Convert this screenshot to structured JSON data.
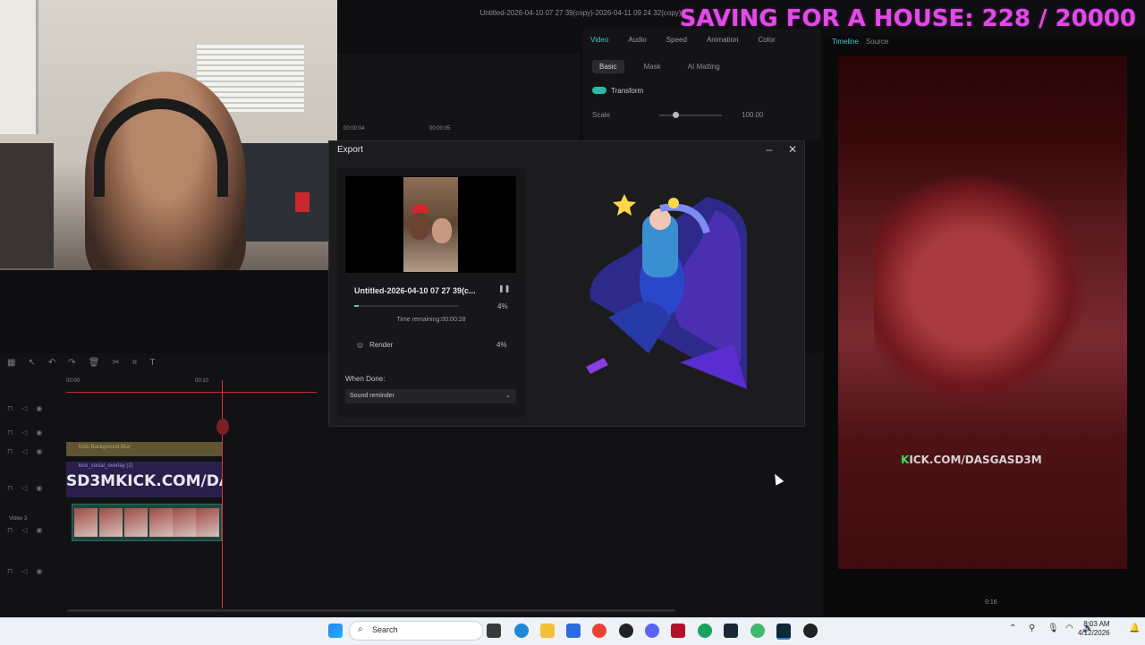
{
  "window": {
    "title": "Untitled-2026-04-10 07 27 39(copy)-2026-04-11 09 24 32(copy)"
  },
  "overlay": {
    "goal_text": "SAVING FOR A HOUSE: 228 / 20000"
  },
  "properties": {
    "tabs": [
      "Video",
      "Audio",
      "Speed",
      "Animation",
      "Color"
    ],
    "subtabs": [
      "Basic",
      "Mask",
      "AI Matting"
    ],
    "transform_label": "Transform",
    "scale_label": "Scale",
    "scale_value": "100.00"
  },
  "preview": {
    "tabs": [
      "Timeline",
      "Source"
    ],
    "watermark_prefix": "K",
    "watermark_rest": "ICK.COM/DASGASD3M",
    "aspect": "9:16"
  },
  "timeline": {
    "ruler": [
      "00:00",
      "00:10"
    ],
    "mini_times": [
      "00:00:04",
      "00:00:05"
    ],
    "tracks": {
      "bg_clip_label": "Kids Background Blur",
      "overlay_clip_label": "kick_social_overlay (2)",
      "overlay_text": "SD3MKICK.COM/DA",
      "video_label": "Video 3"
    }
  },
  "export": {
    "title": "Export",
    "filename": "Untitled-2026-04-10 07 27 39(c...",
    "progress_percent": "4%",
    "progress_fraction": 0.04,
    "time_remaining": "Time remaining:00:00:28",
    "render_label": "Render",
    "render_percent": "4%",
    "when_done_label": "When Done:",
    "when_done_value": "Sound reminder"
  },
  "taskbar": {
    "search_placeholder": "Search",
    "time": "8:03 AM",
    "date": "4/12/2026"
  },
  "colors": {
    "accent": "#45c6c9",
    "goal": "#e04be6",
    "playhead": "#d8323c"
  }
}
